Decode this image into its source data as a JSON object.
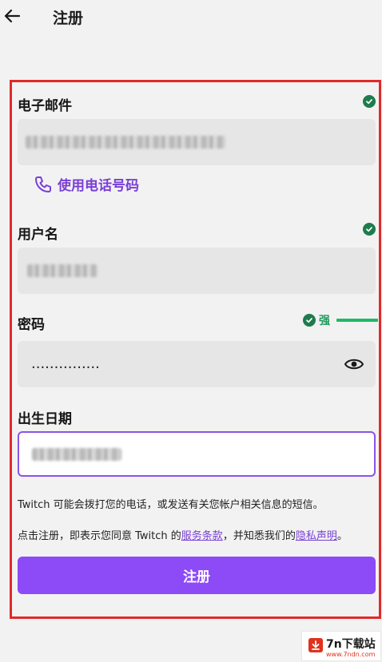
{
  "header": {
    "title": "注册"
  },
  "email": {
    "label": "电子邮件"
  },
  "phone_link": {
    "label": "使用电话号码"
  },
  "username": {
    "label": "用户名"
  },
  "password": {
    "label": "密码",
    "value": "...............",
    "strength_label": "强"
  },
  "birthdate": {
    "label": "出生日期"
  },
  "notes": {
    "line1": "Twitch 可能会拨打您的电话，或发送有关您帐户相关信息的短信。",
    "line2_prefix": "点击注册，即表示您同意 Twitch 的",
    "terms_link": "服务条款",
    "line2_middle": "，并知悉我们的",
    "privacy_link": "隐私声明",
    "line2_suffix": "。"
  },
  "submit": {
    "label": "注册"
  },
  "watermark": {
    "title": "7n下载站",
    "url": "www.7ndn.com"
  },
  "colors": {
    "accent": "#8c4bf7",
    "success": "#1e7b4e",
    "frame": "#e02a2a"
  },
  "icons": [
    "back-arrow-icon",
    "check-icon",
    "phone-icon",
    "eye-icon",
    "download-icon"
  ]
}
